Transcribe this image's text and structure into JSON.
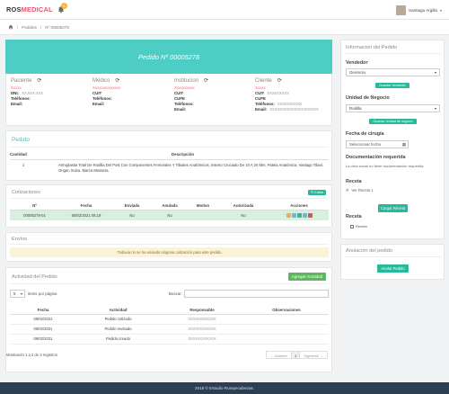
{
  "app": {
    "logo_a": "ROS",
    "logo_b": "MEDICAL",
    "notif_count": "1"
  },
  "user": {
    "name": "Santiago Argilla"
  },
  "breadcrumb": {
    "sep1": "/",
    "item1": "Pedidos",
    "sep2": "/",
    "item2": "Nº 00005278"
  },
  "order": {
    "title": "Pedido Nº 00005278"
  },
  "parties": [
    {
      "title": "Paciente",
      "name": "Xxxxx",
      "l1k": "DNI:",
      "l1v": "XX.XXX.XXX",
      "l2k": "Teléfonos:",
      "l2v": "",
      "l3k": "Email:",
      "l3v": ""
    },
    {
      "title": "Médico",
      "name": "Xxxxxxxxxxxxxx",
      "l1k": "CUIT",
      "l1v": "",
      "l2k": "Teléfonos:",
      "l2v": "",
      "l3k": "Email:",
      "l3v": ""
    },
    {
      "title": "Institucion",
      "name": "Xxxxxxxxxx",
      "l1k": "CUIT",
      "l1v": "",
      "l2k": "CUFE",
      "l2v": "",
      "l3k": "Teléfonos:",
      "l3v": "",
      "l4k": "Email:",
      "l4v": ""
    },
    {
      "title": "Cliente",
      "name": "Xxxxx",
      "l1k": "CUIT",
      "l1v": "XXXXXXXXX",
      "l2k": "CUFE",
      "l2v": "",
      "l3k": "Teléfonos:",
      "l3v": "XXXXXXXXXX",
      "l4k": "Email:",
      "l4v": "XXXXXXXXXXXXXXXXXXXX"
    }
  ],
  "pedido": {
    "title": "Pedido",
    "col_qty": "Cantidad",
    "col_desc": "Descripción",
    "rows": [
      {
        "qty": "1",
        "desc": "Artroplastia Total De Rodilla Del Post Con Componentes Femorales Y Tibiales Anatómicos, Inserto Cruciado De 10 A 20 Mm, Patela Anatómica, Vastago Tibial. Origen Suiza. Marca Medacta."
      }
    ]
  },
  "cotizaciones": {
    "title": "Cotizaciones",
    "edit_btn": "Editar",
    "headers": [
      "Nº",
      "Fecha",
      "Enviada",
      "Anulada",
      "Motivo",
      "Autorizada",
      "Acciones"
    ],
    "rows": [
      {
        "num": "00005278-01",
        "fecha": "09/02/2021 06:19",
        "enviada": "No",
        "anulada": "No",
        "motivo": "",
        "autorizada": "No"
      }
    ]
  },
  "envios": {
    "title": "Envíos",
    "empty_msg": "Todavía no se ha enviado ninguna cotización para este pedido"
  },
  "actividad": {
    "title": "Actividad del Pedido",
    "add_btn": "Agregar Actividad",
    "page_size": "5",
    "items_label": "items por página",
    "search_label": "Buscar:",
    "headers": [
      "Fecha",
      "Actividad",
      "Responsable",
      "Observaciones"
    ],
    "rows": [
      {
        "fecha": "09/02/2021",
        "actividad": "Pedido cotizado",
        "responsable": "XXXXXXXXXXXX",
        "obs": ""
      },
      {
        "fecha": "09/02/2021",
        "actividad": "Pedido revisado",
        "responsable": "XXXXXXXXXXXX",
        "obs": ""
      },
      {
        "fecha": "09/02/2021",
        "actividad": "Pedido creado",
        "responsable": "XXXXXXXXXXXX",
        "obs": ""
      }
    ],
    "showing": "Mostrando 1 a 3 de 3 registros",
    "prev": "← Anterior",
    "page": "1",
    "next": "Siguiente →"
  },
  "info": {
    "title": "Información del Pedido",
    "vendedor_label": "Vendedor",
    "vendedor_value": "Gerencia",
    "vendedor_btn": "Guardar Vendedor",
    "unidad_label": "Unidad de Negocio",
    "unidad_value": "Rodilla",
    "unidad_btn": "Guardar Unidad de negocio",
    "cirugia_label": "Fecha de cirugía",
    "cirugia_placeholder": "Seleccionar fecha",
    "doc_label": "Documentación requerida",
    "doc_text": "La obra social no tiene documentación requerida",
    "receta1_label": "Receta",
    "receta1_link": "Ver Receta 1",
    "cargar_btn": "Cargar Receta",
    "receta2_label": "Receta",
    "receta2_check": "Receta"
  },
  "anulacion": {
    "title": "Anulación del pedido",
    "btn": "Anular Pedido"
  },
  "footer": {
    "text": "2018 © Estudio Rompecabezas."
  },
  "colors": {
    "teal": "#4ecdc4",
    "green": "#26b99a",
    "danger": "#e57373"
  }
}
